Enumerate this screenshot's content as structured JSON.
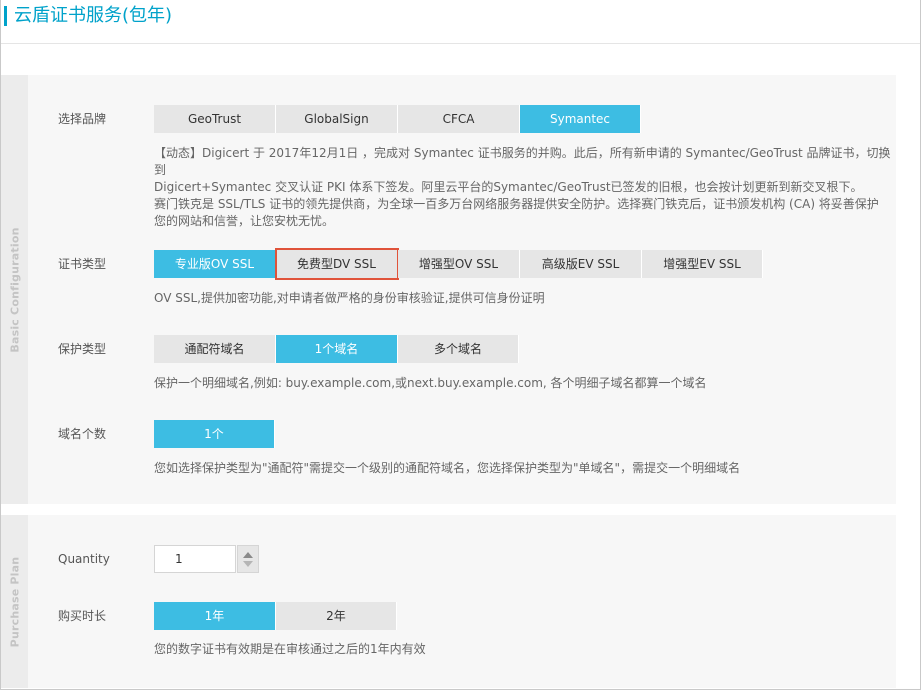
{
  "header": {
    "title": "云盾证书服务(包年)"
  },
  "basic_config": {
    "side_label": "Basic Configuration",
    "brand": {
      "label": "选择品牌",
      "options": [
        "GeoTrust",
        "GlobalSign",
        "CFCA",
        "Symantec"
      ],
      "selected": "Symantec",
      "description": [
        "【动态】Digicert 于 2017年12月1日 ，完成对 Symantec 证书服务的并购。此后，所有新申请的 Symantec/GeoTrust 品牌证书，切换到",
        "Digicert+Symantec 交叉认证 PKI 体系下签发。阿里云平台的Symantec/GeoTrust已签发的旧根，也会按计划更新到新交叉根下。",
        "赛门铁克是 SSL/TLS 证书的领先提供商，为全球一百多万台网络服务器提供安全防护。选择赛门铁克后，证书颁发机构 (CA) 将妥善保护",
        "您的网站和信誉，让您安枕无忧。"
      ]
    },
    "cert_type": {
      "label": "证书类型",
      "options": [
        "专业版OV SSL",
        "免费型DV SSL",
        "增强型OV SSL",
        "高级版EV SSL",
        "增强型EV SSL"
      ],
      "selected": "专业版OV SSL",
      "highlighted": "免费型DV SSL",
      "highlight_color": "#e0533a",
      "description": "OV SSL,提供加密功能,对申请者做严格的身份审核验证,提供可信身份证明"
    },
    "protect_type": {
      "label": "保护类型",
      "options": [
        "通配符域名",
        "1个域名",
        "多个域名"
      ],
      "selected": "1个域名",
      "description": "保护一个明细域名,例如: buy.example.com,或next.buy.example.com, 各个明细子域名都算一个域名"
    },
    "domain_count": {
      "label": "域名个数",
      "options": [
        "1个"
      ],
      "selected": "1个",
      "description": "您如选择保护类型为\"通配符\"需提交一个级别的通配符域名，您选择保护类型为\"单域名\"，需提交一个明细域名"
    }
  },
  "purchase_plan": {
    "side_label": "Purchase Plan",
    "quantity": {
      "label": "Quantity",
      "value": "1"
    },
    "duration": {
      "label": "购买时长",
      "options": [
        "1年",
        "2年"
      ],
      "selected": "1年",
      "description": "您的数字证书有效期是在审核通过之后的1年内有效"
    }
  },
  "colors": {
    "accent": "#3dbde3",
    "title": "#00a2ca",
    "inactive": "#e6e6e6"
  }
}
